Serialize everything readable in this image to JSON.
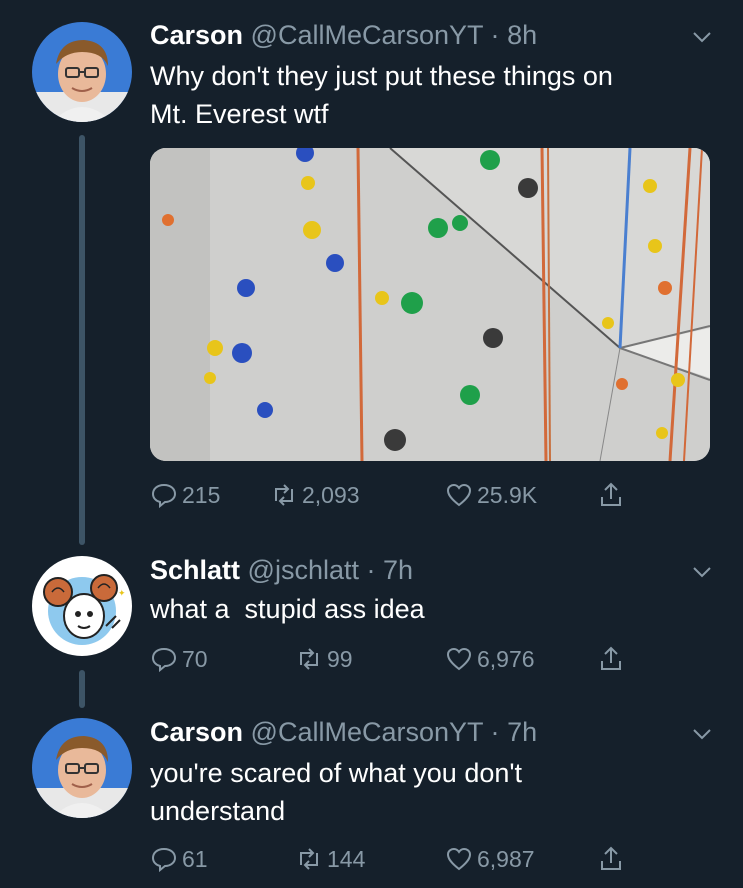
{
  "tweets": [
    {
      "name": "Carson",
      "handle": "@CallMeCarsonYT",
      "sep": "·",
      "time": "8h",
      "text_lines": [
        "Why don't they just put these things on",
        "Mt. Everest wtf"
      ],
      "replies": "215",
      "retweets": "2,093",
      "likes": "25.9K",
      "avatar_icon": "person-avatar",
      "media": "climbing-wall-photo"
    },
    {
      "name": "Schlatt",
      "handle": "@jschlatt",
      "sep": "·",
      "time": "7h",
      "text_lines": [
        "what a  stupid ass idea"
      ],
      "replies": "70",
      "retweets": "99",
      "likes": "6,976",
      "avatar_icon": "cartoon-ram-avatar"
    },
    {
      "name": "Carson",
      "handle": "@CallMeCarsonYT",
      "sep": "·",
      "time": "7h",
      "text_lines": [
        "you're scared of what you don't",
        "understand"
      ],
      "replies": "61",
      "retweets": "144",
      "likes": "6,987",
      "avatar_icon": "person-avatar"
    }
  ],
  "colors": {
    "background": "#15202b",
    "muted": "#8899a6",
    "thread_line": "#3d5466"
  }
}
